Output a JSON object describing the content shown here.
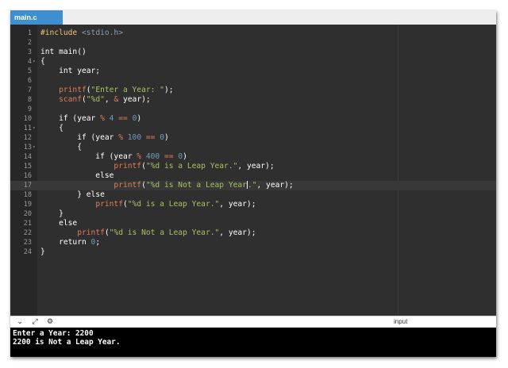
{
  "tab": {
    "label": "main.c"
  },
  "editor": {
    "active_line": 17,
    "lines": [
      {
        "num": "1",
        "fold": false,
        "tokens": [
          [
            "pp",
            "#include"
          ],
          [
            "plain",
            " "
          ],
          [
            "inc",
            "<stdio.h>"
          ]
        ]
      },
      {
        "num": "2",
        "fold": false,
        "tokens": []
      },
      {
        "num": "3",
        "fold": false,
        "tokens": [
          [
            "plain",
            "int main()"
          ]
        ]
      },
      {
        "num": "4",
        "fold": true,
        "tokens": [
          [
            "plain",
            "{"
          ]
        ]
      },
      {
        "num": "5",
        "fold": false,
        "tokens": [
          [
            "plain",
            "    int year;"
          ]
        ]
      },
      {
        "num": "6",
        "fold": false,
        "tokens": []
      },
      {
        "num": "7",
        "fold": false,
        "tokens": [
          [
            "plain",
            "    "
          ],
          [
            "func",
            "printf"
          ],
          [
            "plain",
            "("
          ],
          [
            "str",
            "\"Enter a Year: \""
          ],
          [
            "plain",
            ");"
          ]
        ]
      },
      {
        "num": "8",
        "fold": false,
        "tokens": [
          [
            "plain",
            "    "
          ],
          [
            "func",
            "scanf"
          ],
          [
            "plain",
            "("
          ],
          [
            "str",
            "\"%d\""
          ],
          [
            "plain",
            ", "
          ],
          [
            "op",
            "&"
          ],
          [
            "plain",
            " year);"
          ]
        ]
      },
      {
        "num": "9",
        "fold": false,
        "tokens": []
      },
      {
        "num": "10",
        "fold": false,
        "tokens": [
          [
            "plain",
            "    if (year "
          ],
          [
            "op",
            "%"
          ],
          [
            "plain",
            " "
          ],
          [
            "num",
            "4"
          ],
          [
            "plain",
            " "
          ],
          [
            "op",
            "=="
          ],
          [
            "plain",
            " "
          ],
          [
            "num",
            "0"
          ],
          [
            "plain",
            ")"
          ]
        ]
      },
      {
        "num": "11",
        "fold": true,
        "tokens": [
          [
            "plain",
            "    {"
          ]
        ]
      },
      {
        "num": "12",
        "fold": false,
        "tokens": [
          [
            "plain",
            "        if (year "
          ],
          [
            "op",
            "%"
          ],
          [
            "plain",
            " "
          ],
          [
            "num",
            "100"
          ],
          [
            "plain",
            " "
          ],
          [
            "op",
            "=="
          ],
          [
            "plain",
            " "
          ],
          [
            "num",
            "0"
          ],
          [
            "plain",
            ")"
          ]
        ]
      },
      {
        "num": "13",
        "fold": true,
        "tokens": [
          [
            "plain",
            "        {"
          ]
        ]
      },
      {
        "num": "14",
        "fold": false,
        "tokens": [
          [
            "plain",
            "            if (year "
          ],
          [
            "op",
            "%"
          ],
          [
            "plain",
            " "
          ],
          [
            "num",
            "400"
          ],
          [
            "plain",
            " "
          ],
          [
            "op",
            "=="
          ],
          [
            "plain",
            " "
          ],
          [
            "num",
            "0"
          ],
          [
            "plain",
            ")"
          ]
        ]
      },
      {
        "num": "15",
        "fold": false,
        "tokens": [
          [
            "plain",
            "                "
          ],
          [
            "func",
            "printf"
          ],
          [
            "plain",
            "("
          ],
          [
            "str",
            "\"%d is a Leap Year.\""
          ],
          [
            "plain",
            ", year);"
          ]
        ]
      },
      {
        "num": "16",
        "fold": false,
        "tokens": [
          [
            "plain",
            "            else"
          ]
        ]
      },
      {
        "num": "17",
        "fold": false,
        "tokens": [
          [
            "plain",
            "                "
          ],
          [
            "func",
            "printf"
          ],
          [
            "plain",
            "("
          ],
          [
            "str",
            "\"%d is Not a Leap Year"
          ],
          [
            "cursor",
            ""
          ],
          [
            "str",
            ".\""
          ],
          [
            "plain",
            ", year);"
          ]
        ]
      },
      {
        "num": "18",
        "fold": false,
        "tokens": [
          [
            "plain",
            "        } else"
          ]
        ]
      },
      {
        "num": "19",
        "fold": false,
        "tokens": [
          [
            "plain",
            "            "
          ],
          [
            "func",
            "printf"
          ],
          [
            "plain",
            "("
          ],
          [
            "str",
            "\"%d is a Leap Year.\""
          ],
          [
            "plain",
            ", year);"
          ]
        ]
      },
      {
        "num": "20",
        "fold": false,
        "tokens": [
          [
            "plain",
            "    }"
          ]
        ]
      },
      {
        "num": "21",
        "fold": false,
        "tokens": [
          [
            "plain",
            "    else"
          ]
        ]
      },
      {
        "num": "22",
        "fold": false,
        "tokens": [
          [
            "plain",
            "        "
          ],
          [
            "func",
            "printf"
          ],
          [
            "plain",
            "("
          ],
          [
            "str",
            "\"%d is Not a Leap Year.\""
          ],
          [
            "plain",
            ", year);"
          ]
        ]
      },
      {
        "num": "23",
        "fold": false,
        "tokens": [
          [
            "plain",
            "    return "
          ],
          [
            "num",
            "0"
          ],
          [
            "plain",
            ";"
          ]
        ]
      },
      {
        "num": "24",
        "fold": false,
        "tokens": [
          [
            "plain",
            "}"
          ]
        ]
      }
    ]
  },
  "toolbar": {
    "icons": [
      "chevron-down-icon",
      "expand-icon",
      "run-icon"
    ],
    "icon_glyphs": [
      "⌄",
      "⤢",
      "⚙"
    ],
    "input_label": "input"
  },
  "console": {
    "lines": [
      "Enter a Year: 2200",
      "2200 is Not a Leap Year."
    ]
  },
  "colors": {
    "tab_active": "#3d8fd1",
    "editor_bg": "#2f2f2f",
    "string": "#a5c261",
    "function": "#e07c5a",
    "number": "#6d9cbe",
    "preprocessor": "#e8c36f"
  }
}
